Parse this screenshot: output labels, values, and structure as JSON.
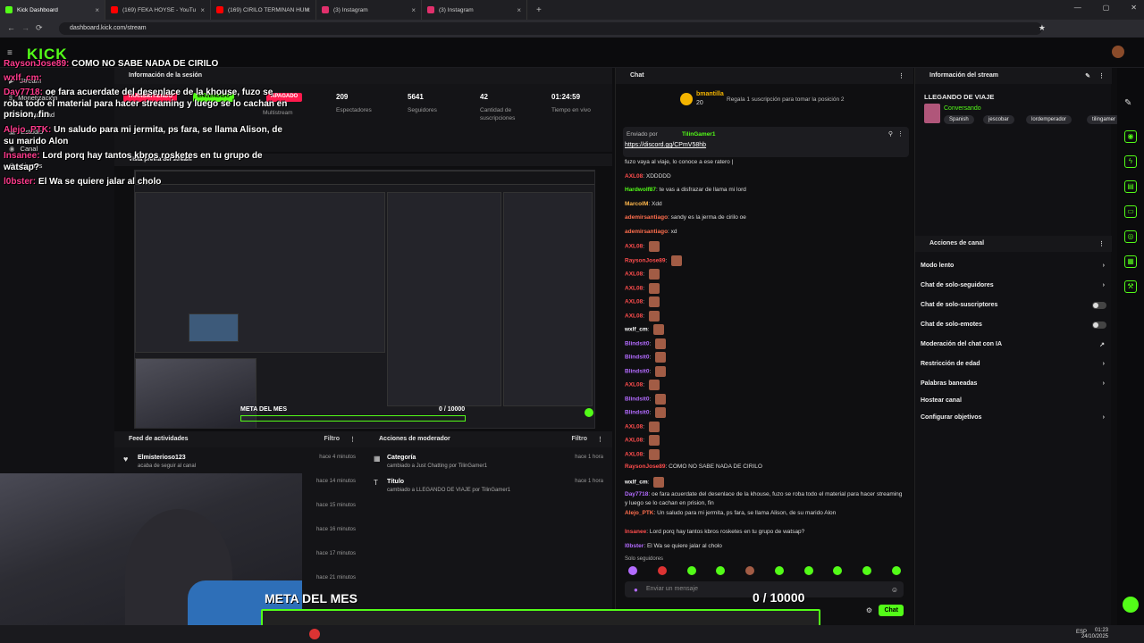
{
  "browser": {
    "tabs": [
      {
        "label": "Kick Dashboard",
        "color": "#53fc18"
      },
      {
        "label": "(169) FEKA HOYSE - YouTu",
        "color": "#ff0000"
      },
      {
        "label": "(169) CIRILO TERMINAN HUM",
        "color": "#ff0000"
      },
      {
        "label": "(3) Instagram",
        "color": "#e1306c"
      },
      {
        "label": "(3) Instagram",
        "color": "#e1306c"
      }
    ],
    "url": "dashboard.kick.com/stream"
  },
  "brand": {
    "logo": "KICK",
    "accent": "#53fc18"
  },
  "sidebar": {
    "items": [
      "Stream",
      "Monetización",
      "Comunidad",
      "Estudio",
      "Canal",
      "Ajustes"
    ]
  },
  "session": {
    "title": "Información de la sesión",
    "badges": [
      "TRANSMITIENDO",
      "ENCENDIDO",
      "APAGADO"
    ],
    "multistream": "Multistream",
    "stats": [
      {
        "value": "209",
        "label": "Espectadores"
      },
      {
        "value": "5641",
        "label": "Seguidores"
      },
      {
        "value": "42",
        "label": "Cantidad de suscripciones"
      },
      {
        "value": "01:24:59",
        "label": "Tiempo en vivo"
      }
    ]
  },
  "preview": {
    "title": "Vista previa del stream",
    "goal_label": "META DEL MES",
    "goal_count": "0 / 10000"
  },
  "feed": {
    "title": "Feed de actividades",
    "filter": "Filtro",
    "items": [
      {
        "user": "Elmisterioso123",
        "action": "acaba de seguir al canal",
        "time": "hace 4 minutos"
      },
      {
        "user": "",
        "action": "",
        "time": "hace 14 minutos"
      },
      {
        "user": "",
        "action": "",
        "time": "hace 15 minutos"
      },
      {
        "user": "",
        "action": "",
        "time": "hace 16 minutos"
      },
      {
        "user": "",
        "action": "",
        "time": "hace 17 minutos"
      },
      {
        "user": "",
        "action": "",
        "time": "hace 21 minutos"
      }
    ]
  },
  "mod": {
    "title": "Acciones de moderador",
    "filter": "Filtro",
    "items": [
      {
        "title": "Categoría",
        "detail": "cambiado a Just Chatting por TilinGamer1",
        "time": "hace 1 hora"
      },
      {
        "title": "Título",
        "detail": "cambiado a LLEGANDO DE VIAJE por TilinGamer1",
        "time": "hace 1 hora"
      }
    ]
  },
  "chat": {
    "title": "Chat",
    "top_user": "bmantilla",
    "top_amount": "20",
    "gift_text": "Regala 1 suscripción para tomar la posición 2",
    "pinned_by": "Enviado por",
    "pinned_user": "TilinGamer1",
    "pinned_link": "https://discord.gg/CPmV58hb",
    "messages": [
      {
        "user": "",
        "text": "fuzo vaya al viaje, lo conoce a ese ratero |",
        "color": "#dddddd",
        "emotes": 0
      },
      {
        "user": "AXL08",
        "text": "XDDDDD",
        "color": "#ff4d4d",
        "emotes": 0
      },
      {
        "user": "Hardwolf87",
        "text": "te vas a disfrazar de llama mi lord",
        "color": "#53fc18",
        "emotes": 0
      },
      {
        "user": "MarcoIM",
        "text": "Xdd",
        "color": "#ffb84d",
        "emotes": 0
      },
      {
        "user": "ademirsantiago",
        "text": "sandy es la jerma de cirilo oe",
        "color": "#ff6e4d",
        "emotes": 0
      },
      {
        "user": "ademirsantiago",
        "text": "xd",
        "color": "#ff6e4d",
        "emotes": 0
      },
      {
        "user": "AXL08",
        "text": "",
        "color": "#ff4d4d",
        "emotes": 1
      },
      {
        "user": "RaysonJose89",
        "text": "",
        "color": "#ff4d4d",
        "emotes": 1
      },
      {
        "user": "AXL08",
        "text": "",
        "color": "#ff4d4d",
        "emotes": 1
      },
      {
        "user": "AXL08",
        "text": "",
        "color": "#ff4d4d",
        "emotes": 1
      },
      {
        "user": "AXL08",
        "text": "",
        "color": "#ff4d4d",
        "emotes": 1
      },
      {
        "user": "AXL08",
        "text": "",
        "color": "#ff4d4d",
        "emotes": 1
      },
      {
        "user": "wxlf_cm",
        "text": "",
        "color": "#ffffff",
        "emotes": 1
      },
      {
        "user": "Blindsit0",
        "text": "",
        "color": "#b36bff",
        "emotes": 1
      },
      {
        "user": "Blindsit0",
        "text": "",
        "color": "#b36bff",
        "emotes": 1
      },
      {
        "user": "Blindsit0",
        "text": "",
        "color": "#b36bff",
        "emotes": 1
      },
      {
        "user": "AXL08",
        "text": "",
        "color": "#ff4d4d",
        "emotes": 1
      },
      {
        "user": "Blindsit0",
        "text": "",
        "color": "#b36bff",
        "emotes": 1
      },
      {
        "user": "Blindsit0",
        "text": "",
        "color": "#b36bff",
        "emotes": 1
      },
      {
        "user": "AXL08",
        "text": "",
        "color": "#ff4d4d",
        "emotes": 1
      },
      {
        "user": "AXL08",
        "text": "",
        "color": "#ff4d4d",
        "emotes": 1
      },
      {
        "user": "AXL08",
        "text": "",
        "color": "#ff4d4d",
        "emotes": 1
      },
      {
        "user": "RaysonJose89",
        "text": "COMO NO SABE NADA DE CIRILO",
        "color": "#ff4d4d",
        "emotes": 0
      },
      {
        "user": "wxlf_cm",
        "text": "",
        "color": "#ffffff",
        "emotes": 1
      },
      {
        "user": "Day7718",
        "text": "oe fara acuerdate del desenlace de la khouse, fuzo se roba todo el material para hacer streaming y luego se lo cachan en prision, fin",
        "color": "#b36bff",
        "emotes": 0
      },
      {
        "user": "Alejo_PTK",
        "text": "Un saludo para mi jermita, ps fara, se llama Alison, de su marido Alon",
        "color": "#ff6e4d",
        "emotes": 0
      },
      {
        "user": "Insanee",
        "text": "Lord porq hay tantos kbros rosketes en tu grupo de watsap?",
        "color": "#ff4d4d",
        "emotes": 0
      },
      {
        "user": "l0bster",
        "text": "El Wa se quiere jalar al cholo",
        "color": "#b36bff",
        "emotes": 0
      }
    ],
    "followers_only": "Solo seguidores",
    "input_placeholder": "Enviar un mensaje",
    "send_label": "Chat"
  },
  "stream_info": {
    "title": "Información del stream",
    "stream_title": "LLEGANDO DE VIAJE",
    "category": "Conversando",
    "tags": [
      "Spanish",
      "jescobar",
      "lordemperador",
      "tilingamer"
    ]
  },
  "channel_actions": {
    "title": "Acciones de canal",
    "items": [
      {
        "label": "Modo lento",
        "kind": "chevron"
      },
      {
        "label": "Chat de solo-seguidores",
        "kind": "chevron"
      },
      {
        "label": "Chat de solo-suscriptores",
        "kind": "toggle"
      },
      {
        "label": "Chat de solo-emotes",
        "kind": "toggle"
      },
      {
        "label": "Moderación del chat con IA",
        "kind": "external"
      },
      {
        "label": "Restricción de edad",
        "kind": "chevron"
      },
      {
        "label": "Palabras baneadas",
        "kind": "chevron"
      },
      {
        "label": "Hostear canal",
        "kind": "none"
      },
      {
        "label": "Configurar objetivos",
        "kind": "chevron"
      }
    ]
  },
  "overlay": {
    "messages": [
      {
        "user": "RaysonJose89:",
        "text": "COMO NO SABE NADA DE CIRILO"
      },
      {
        "user": "wxlf_cm:",
        "text": ""
      },
      {
        "user": "Day7718:",
        "text": "oe fara acuerdate del desenlace de la khouse, fuzo se roba todo el material para hacer streaming y luego se lo cachan en prision, fin"
      },
      {
        "user": "Alejo_PTK:",
        "text": "Un saludo para mi jermita, ps fara, se llama Alison, de su marido Alon"
      },
      {
        "user": "Insanee:",
        "text": "Lord porq hay tantos kbros rosketes en tu grupo de watsap?"
      },
      {
        "user": "l0bster:",
        "text": "El Wa se quiere jalar al cholo"
      }
    ],
    "goal_title": "META DEL MES",
    "goal_count": "0  / 10000",
    "goal_progress": 0
  },
  "taskbar": {
    "lang": "ESP",
    "time": "01:23",
    "date": "24/10/2025"
  }
}
